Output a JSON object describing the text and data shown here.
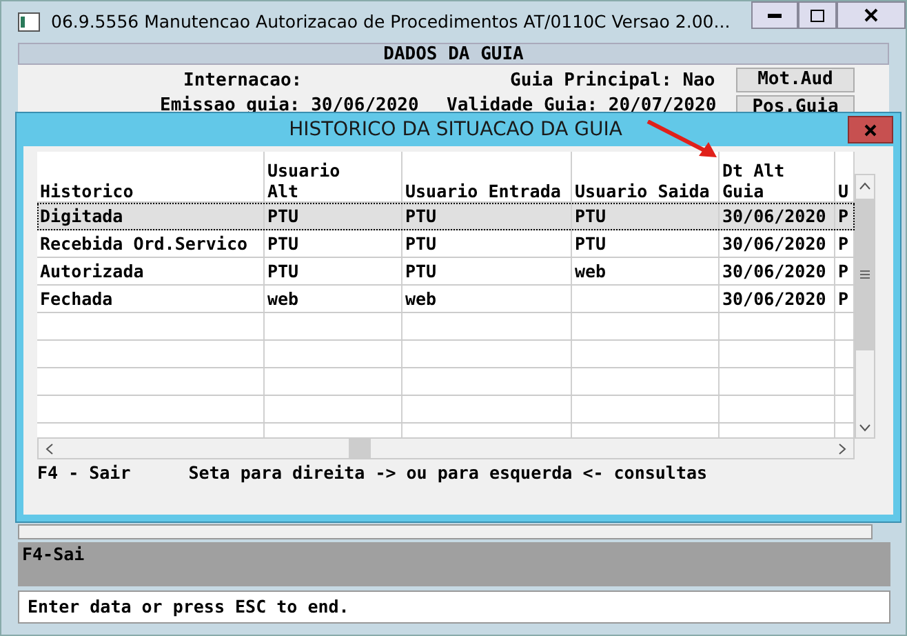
{
  "window": {
    "title": "06.9.5556 Manutencao Autorizacao de Procedimentos AT/0110C Versao 2.00..."
  },
  "form": {
    "header": "DADOS DA GUIA",
    "internacao_label": "Internacao:",
    "guia_principal": "Guia Principal: Nao",
    "emissao": "Emissao guia: 30/06/2020",
    "validade": "Validade Guia: 20/07/2020",
    "buttons": [
      "Mot.Aud",
      "Pos.Guia"
    ]
  },
  "dialog": {
    "title": "HISTORICO DA SITUACAO DA GUIA",
    "table": {
      "columns": [
        "Historico",
        "Usuario\nAlt",
        "Usuario Entrada",
        "Usuario Saida",
        "Dt Alt\nGuia",
        "U"
      ],
      "rows": [
        {
          "cells": [
            "Digitada",
            "PTU",
            "PTU",
            "PTU",
            "30/06/2020",
            "P"
          ],
          "selected": true
        },
        {
          "cells": [
            "Recebida Ord.Servico",
            "PTU",
            "PTU",
            "PTU",
            "30/06/2020",
            "P"
          ],
          "selected": false
        },
        {
          "cells": [
            "Autorizada",
            "PTU",
            "PTU",
            "web",
            "30/06/2020",
            "P"
          ],
          "selected": false
        },
        {
          "cells": [
            "Fechada",
            "web",
            "web",
            "",
            "30/06/2020",
            "P"
          ],
          "selected": false
        }
      ]
    },
    "hint_key": "F4 - Sair",
    "hint_text": "Seta para direita -> ou para esquerda <- consultas"
  },
  "function_bar": "F4-Sai",
  "status_bar": "Enter data or press ESC to end."
}
